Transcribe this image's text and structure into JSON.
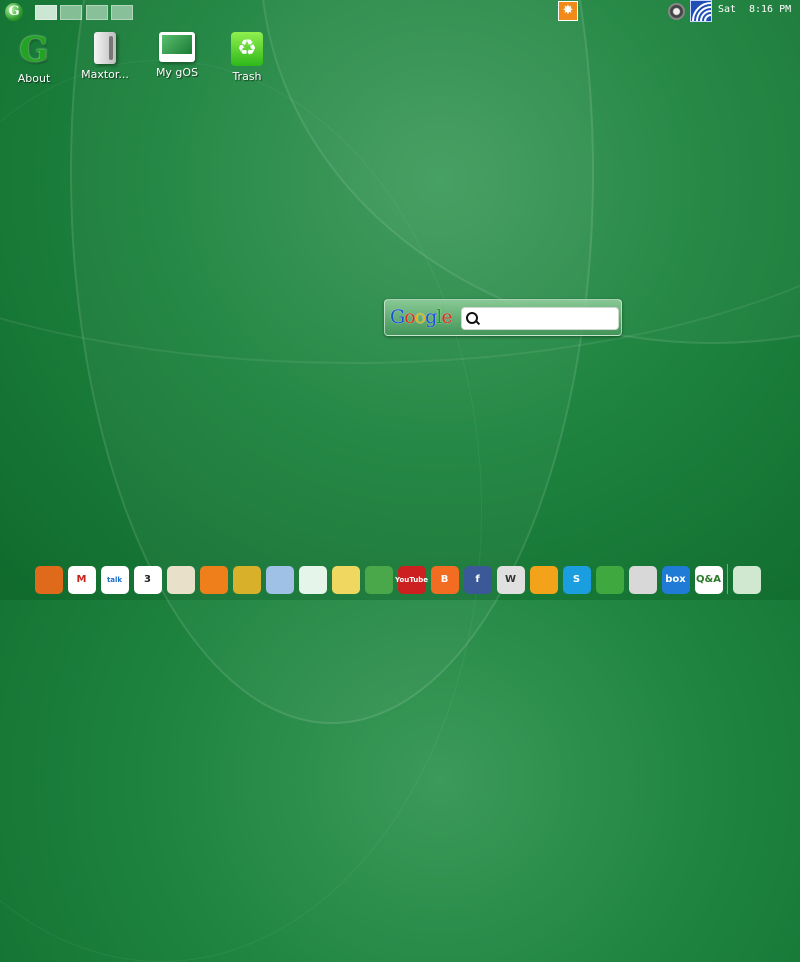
{
  "top_panel": {
    "logo_letter": "G",
    "workspaces": [
      {
        "active": true
      },
      {
        "active": false
      },
      {
        "active": false
      },
      {
        "active": false
      }
    ],
    "tray": [
      "notification-icon",
      "speaker-icon",
      "wifi-icon"
    ],
    "clock": {
      "day": "Sat",
      "time": "8:16 PM"
    }
  },
  "desktop_icons": [
    {
      "label": "About",
      "icon": "gos-about-icon"
    },
    {
      "label": "Maxtor...",
      "icon": "drive-icon"
    },
    {
      "label": "My gOS",
      "icon": "monitor-icon"
    },
    {
      "label": "Trash",
      "icon": "trash-icon"
    }
  ],
  "google_widget": {
    "logo_letters": [
      "G",
      "o",
      "o",
      "g",
      "l",
      "e"
    ],
    "logo_colors": [
      "#1a4fd6",
      "#d62c1a",
      "#e8b00e",
      "#1a4fd6",
      "#1a9b2a",
      "#d62c1a"
    ],
    "search_value": ""
  },
  "dock": {
    "items": [
      {
        "name": "firefox-icon",
        "text": "",
        "bg": "#e06a1b"
      },
      {
        "name": "gmail-icon",
        "text": "M",
        "bg": "#ffffff",
        "fg": "#c9241b"
      },
      {
        "name": "gtalk-icon",
        "text": "talk",
        "bg": "#ffffff",
        "fg": "#1b6fc9"
      },
      {
        "name": "calendar-icon",
        "text": "3",
        "bg": "#ffffff",
        "fg": "#222222"
      },
      {
        "name": "notes-icon",
        "text": "",
        "bg": "#e8e0c8"
      },
      {
        "name": "rss-icon",
        "text": "",
        "bg": "#ef7f1a"
      },
      {
        "name": "contacts-icon",
        "text": "",
        "bg": "#d9b02a"
      },
      {
        "name": "maps-icon",
        "text": "",
        "bg": "#9fc1e6"
      },
      {
        "name": "stocks-icon",
        "text": "",
        "bg": "#e6f5ea"
      },
      {
        "name": "shopping-icon",
        "text": "",
        "bg": "#f0d860"
      },
      {
        "name": "books-icon",
        "text": "",
        "bg": "#4aa84a"
      },
      {
        "name": "youtube-icon",
        "text": "YouTube",
        "bg": "#cc1f1f"
      },
      {
        "name": "blogger-icon",
        "text": "B",
        "bg": "#f26c22"
      },
      {
        "name": "facebook-icon",
        "text": "f",
        "bg": "#3b5998"
      },
      {
        "name": "wikipedia-icon",
        "text": "W",
        "bg": "#e0e0e0",
        "fg": "#333333"
      },
      {
        "name": "meebo-icon",
        "text": "",
        "bg": "#f2a31a"
      },
      {
        "name": "skype-icon",
        "text": "S",
        "bg": "#1a9ee0"
      },
      {
        "name": "media-player-icon",
        "text": "",
        "bg": "#3fa83f"
      },
      {
        "name": "music-icon",
        "text": "",
        "bg": "#d8d8d8"
      },
      {
        "name": "box-icon",
        "text": "box",
        "bg": "#1f7bd6"
      },
      {
        "name": "qa-icon",
        "text": "Q&A",
        "bg": "#ffffff",
        "fg": "#2a7a2a"
      },
      {
        "name": "settings-icon",
        "text": "",
        "bg": "#cfe8cf"
      }
    ]
  }
}
